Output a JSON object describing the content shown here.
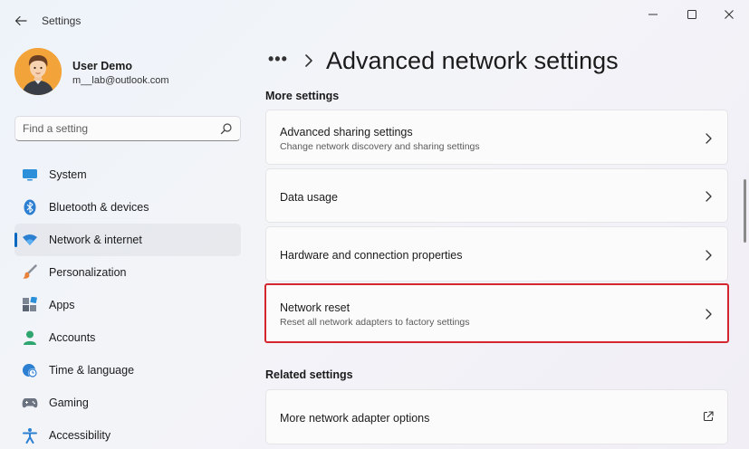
{
  "window": {
    "title": "Settings"
  },
  "user": {
    "name": "User Demo",
    "email": "m__lab@outlook.com"
  },
  "search": {
    "placeholder": "Find a setting"
  },
  "sidebar": {
    "items": [
      {
        "label": "System",
        "icon": "system-icon"
      },
      {
        "label": "Bluetooth & devices",
        "icon": "bluetooth-icon"
      },
      {
        "label": "Network & internet",
        "icon": "wifi-icon",
        "active": true
      },
      {
        "label": "Personalization",
        "icon": "brush-icon"
      },
      {
        "label": "Apps",
        "icon": "apps-icon"
      },
      {
        "label": "Accounts",
        "icon": "person-icon"
      },
      {
        "label": "Time & language",
        "icon": "clock-globe-icon"
      },
      {
        "label": "Gaming",
        "icon": "gamepad-icon"
      },
      {
        "label": "Accessibility",
        "icon": "accessibility-icon"
      }
    ]
  },
  "header": {
    "breadcrumb_more": "•••",
    "title": "Advanced network settings"
  },
  "sections": {
    "more_settings": "More settings",
    "related_settings": "Related settings"
  },
  "cards": {
    "advanced_sharing": {
      "title": "Advanced sharing settings",
      "subtitle": "Change network discovery and sharing settings"
    },
    "data_usage": {
      "title": "Data usage"
    },
    "hardware": {
      "title": "Hardware and connection properties"
    },
    "network_reset": {
      "title": "Network reset",
      "subtitle": "Reset all network adapters to factory settings"
    },
    "adapter_options": {
      "title": "More network adapter options"
    }
  },
  "colors": {
    "accent": "#0067c0",
    "highlight": "#d3262f"
  }
}
